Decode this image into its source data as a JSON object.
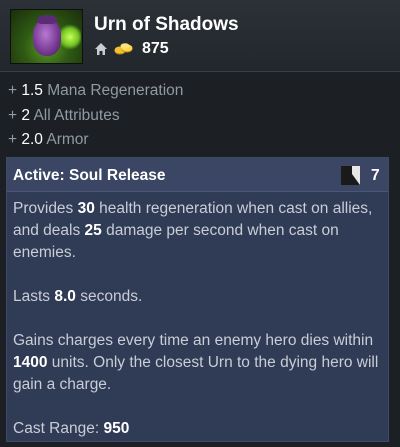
{
  "item": {
    "name": "Urn of Shadows",
    "cost": "875",
    "icon": "urn-of-shadows-icon"
  },
  "attributes": [
    {
      "value": "1.5",
      "name": "Mana Regeneration"
    },
    {
      "value": "2",
      "name": "All Attributes"
    },
    {
      "value": "2.0",
      "name": "Armor"
    }
  ],
  "ability": {
    "title": "Active: Soul Release",
    "charges": "7",
    "description": {
      "p1_a": "Provides ",
      "p1_v1": "30",
      "p1_b": " health regeneration when cast on allies, and deals ",
      "p1_v2": "25",
      "p1_c": " damage per second when cast on enemies.",
      "p2_a": "Lasts ",
      "p2_v": "8.0",
      "p2_b": " seconds.",
      "p3_a": "Gains charges every time an enemy hero dies within ",
      "p3_v": "1400",
      "p3_b": " units. Only the closest Urn to the dying hero will gain a charge.",
      "p4_a": "Cast Range: ",
      "p4_v": "950"
    }
  },
  "colors": {
    "background": "#1c2024",
    "ability_bg": "#303b56",
    "ability_header": "#3a4663",
    "gold": "#e8b923",
    "text_muted": "#8f9aa3"
  }
}
